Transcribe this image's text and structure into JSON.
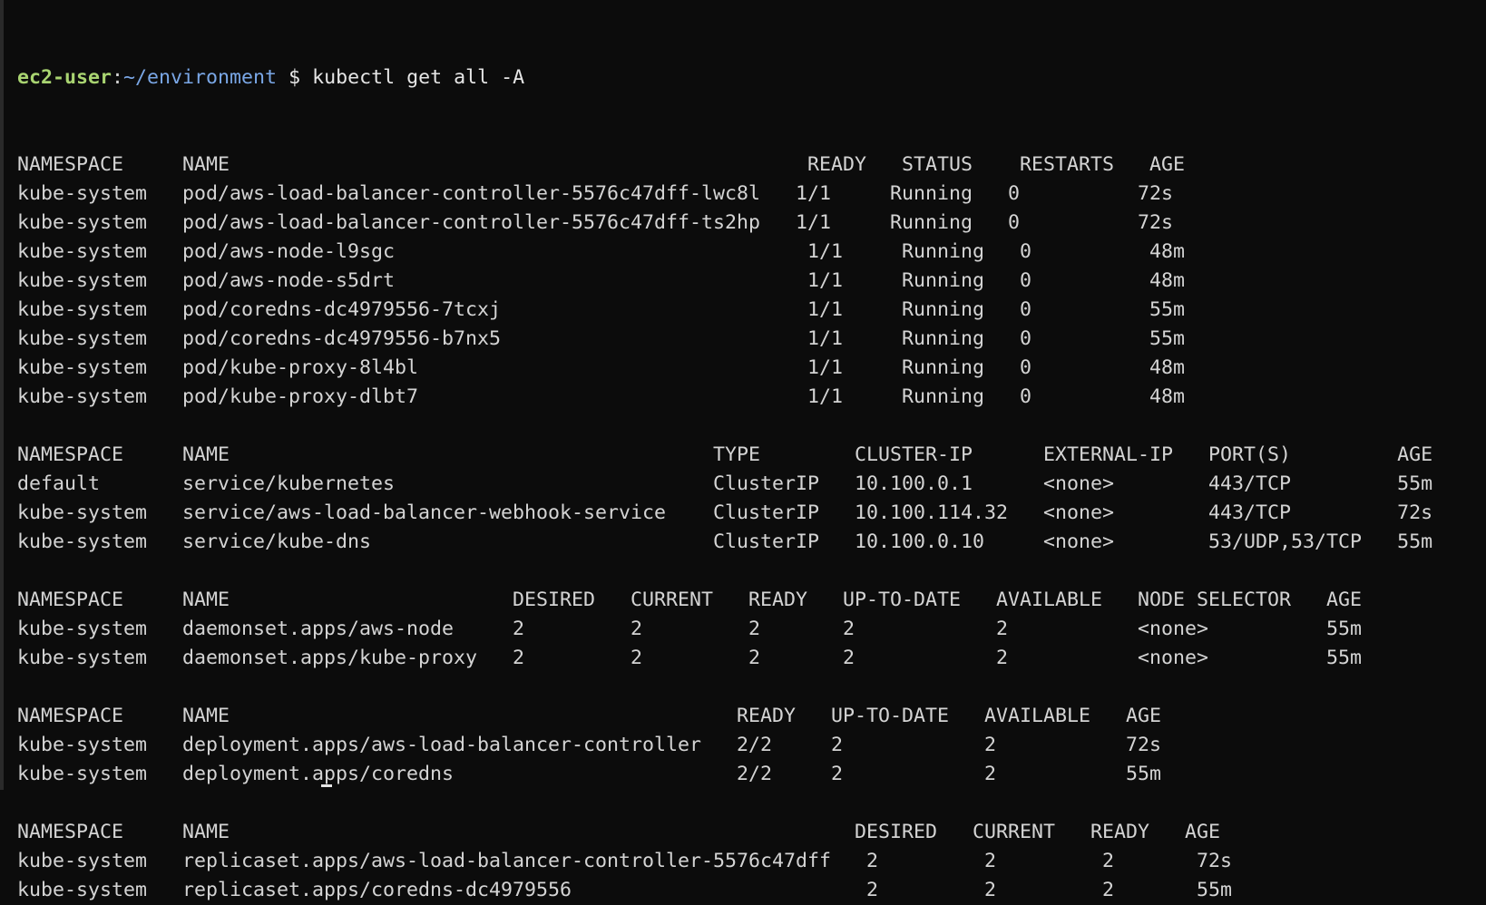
{
  "prompt": {
    "user": "ec2-user",
    "separator": ":",
    "path": "~/environment",
    "symbol": "$",
    "command": "kubectl get all -A"
  },
  "lines": [
    "NAMESPACE     NAME                                                 READY   STATUS    RESTARTS   AGE",
    "kube-system   pod/aws-load-balancer-controller-5576c47dff-lwc8l   1/1     Running   0          72s",
    "kube-system   pod/aws-load-balancer-controller-5576c47dff-ts2hp   1/1     Running   0          72s",
    "kube-system   pod/aws-node-l9sgc                                   1/1     Running   0          48m",
    "kube-system   pod/aws-node-s5drt                                   1/1     Running   0          48m",
    "kube-system   pod/coredns-dc4979556-7tcxj                          1/1     Running   0          55m",
    "kube-system   pod/coredns-dc4979556-b7nx5                          1/1     Running   0          55m",
    "kube-system   pod/kube-proxy-8l4bl                                 1/1     Running   0          48m",
    "kube-system   pod/kube-proxy-dlbt7                                 1/1     Running   0          48m",
    "",
    "NAMESPACE     NAME                                         TYPE        CLUSTER-IP      EXTERNAL-IP   PORT(S)         AGE",
    "default       service/kubernetes                           ClusterIP   10.100.0.1      <none>        443/TCP         55m",
    "kube-system   service/aws-load-balancer-webhook-service    ClusterIP   10.100.114.32   <none>        443/TCP         72s",
    "kube-system   service/kube-dns                             ClusterIP   10.100.0.10     <none>        53/UDP,53/TCP   55m",
    "",
    "NAMESPACE     NAME                        DESIRED   CURRENT   READY   UP-TO-DATE   AVAILABLE   NODE SELECTOR   AGE",
    "kube-system   daemonset.apps/aws-node     2         2         2       2            2           <none>          55m",
    "kube-system   daemonset.apps/kube-proxy   2         2         2       2            2           <none>          55m",
    "",
    "NAMESPACE     NAME                                           READY   UP-TO-DATE   AVAILABLE   AGE",
    "kube-system   deployment.apps/aws-load-balancer-controller   2/2     2            2           72s",
    "kube-system   deployment.apps/coredns                        2/2     2            2           55m",
    "",
    "NAMESPACE     NAME                                                     DESIRED   CURRENT   READY   AGE",
    "kube-system   replicaset.apps/aws-load-balancer-controller-5576c47dff   2         2         2       72s",
    "kube-system   replicaset.apps/coredns-dc4979556                         2         2         2       55m"
  ]
}
